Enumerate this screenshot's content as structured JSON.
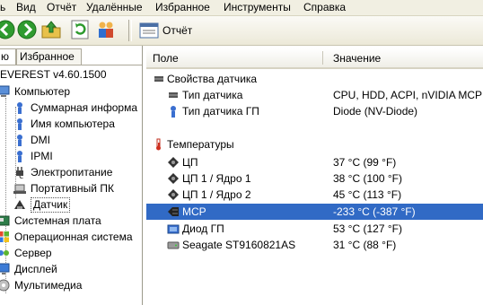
{
  "menu": [
    "ь",
    "Вид",
    "Отчёт",
    "Удалённые",
    "Избранное",
    "Инструменты",
    "Справка"
  ],
  "toolbar": {
    "report_label": "Отчёт"
  },
  "left": {
    "tabs": [
      "ю",
      "Избранное"
    ],
    "tree": [
      {
        "label": "EVEREST v4.60.1500",
        "icon": "everest-icon"
      },
      {
        "label": "Компьютер",
        "icon": "computer-icon"
      },
      {
        "label": "Суммарная информа",
        "icon": "summary-icon"
      },
      {
        "label": "Имя компьютера",
        "icon": "computer-name-icon"
      },
      {
        "label": "DMI",
        "icon": "dmi-icon"
      },
      {
        "label": "IPMI",
        "icon": "ipmi-icon"
      },
      {
        "label": "Электропитание",
        "icon": "power-icon"
      },
      {
        "label": "Портативный ПК",
        "icon": "laptop-icon"
      },
      {
        "label": "Датчик",
        "icon": "sensor-icon"
      },
      {
        "label": "Системная плата",
        "icon": "motherboard-icon"
      },
      {
        "label": "Операционная система",
        "icon": "windows-icon"
      },
      {
        "label": "Сервер",
        "icon": "server-icon"
      },
      {
        "label": "Дисплей",
        "icon": "display-icon"
      },
      {
        "label": "Мультимедиа",
        "icon": "multimedia-icon"
      }
    ]
  },
  "table": {
    "columns": [
      "Поле",
      "Значение"
    ],
    "sections": {
      "sensor_props": "Свойства датчика",
      "temps": "Температуры"
    },
    "rows": [
      {
        "field": "Тип датчика",
        "value": "CPU, HDD, ACPI, nVIDIA MCP",
        "icon": "sensor-chip-icon"
      },
      {
        "field": "Тип датчика ГП",
        "value": "Diode  (NV-Diode)",
        "icon": "gpu-sensor-icon"
      },
      {
        "field": "ЦП",
        "value": "37 °C  (99 °F)",
        "icon": "cpu-icon"
      },
      {
        "field": "ЦП 1 / Ядро 1",
        "value": "38 °C  (100 °F)",
        "icon": "cpu-icon"
      },
      {
        "field": "ЦП 1 / Ядро 2",
        "value": "45 °C  (113 °F)",
        "icon": "cpu-icon"
      },
      {
        "field": "MCP",
        "value": "-233 °C  (-387 °F)",
        "icon": "chip-icon"
      },
      {
        "field": "Диод ГП",
        "value": "53 °C  (127 °F)",
        "icon": "gpu-diode-icon"
      },
      {
        "field": "Seagate ST9160821AS",
        "value": "31 °C  (88 °F)",
        "icon": "hdd-icon"
      }
    ]
  },
  "colors": {
    "selection": "#316ac5",
    "menubar": "#f1efe2"
  }
}
